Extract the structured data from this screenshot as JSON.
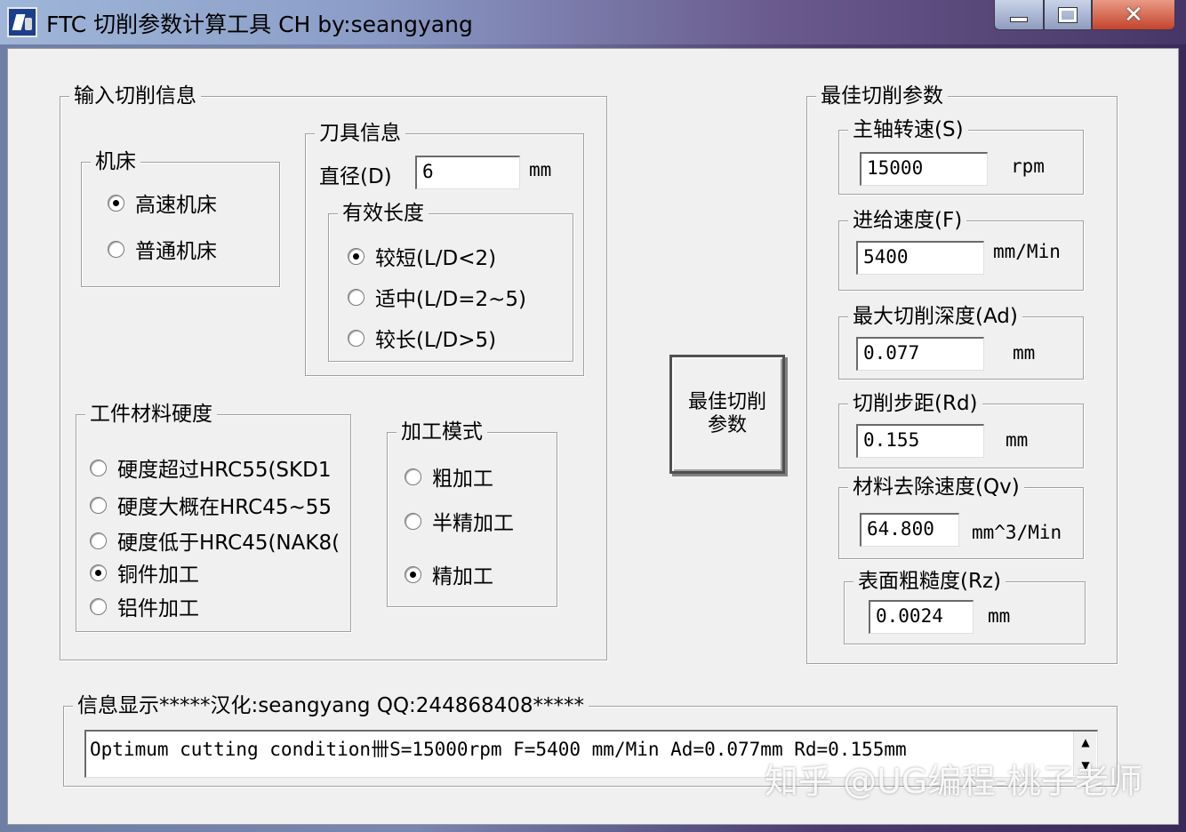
{
  "window": {
    "title": "FTC 切削参数计算工具  CH by:seangyang"
  },
  "input_group": {
    "title": "输入切削信息",
    "machine": {
      "title": "机床",
      "options": [
        {
          "label": "高速机床",
          "selected": true
        },
        {
          "label": "普通机床",
          "selected": false
        }
      ]
    },
    "tool": {
      "title": "刀具信息",
      "diameter_label": "直径(D)",
      "diameter_value": "6",
      "diameter_unit": "mm",
      "length": {
        "title": "有效长度",
        "options": [
          {
            "label": "较短(L/D<2)",
            "selected": true
          },
          {
            "label": "适中(L/D=2~5)",
            "selected": false
          },
          {
            "label": "较长(L/D>5)",
            "selected": false
          }
        ]
      }
    },
    "hardness": {
      "title": "工件材料硬度",
      "options": [
        {
          "label": "硬度超过HRC55(SKD1",
          "selected": false
        },
        {
          "label": "硬度大概在HRC45~55",
          "selected": false
        },
        {
          "label": "硬度低于HRC45(NAK8(",
          "selected": false
        },
        {
          "label": "铜件加工",
          "selected": true
        },
        {
          "label": "铝件加工",
          "selected": false
        }
      ]
    },
    "mode": {
      "title": "加工模式",
      "options": [
        {
          "label": "粗加工",
          "selected": false
        },
        {
          "label": "半精加工",
          "selected": false
        },
        {
          "label": "精加工",
          "selected": true
        }
      ]
    }
  },
  "calc_button": {
    "label": "最佳切削参数"
  },
  "output_group": {
    "title": "最佳切削参数",
    "fields": [
      {
        "title": "主轴转速(S)",
        "value": "15000",
        "unit": "rpm"
      },
      {
        "title": "进给速度(F)",
        "value": "5400",
        "unit": "mm/Min"
      },
      {
        "title": "最大切削深度(Ad)",
        "value": "0.077",
        "unit": "mm"
      },
      {
        "title": "切削步距(Rd)",
        "value": "0.155",
        "unit": "mm"
      },
      {
        "title": "材料去除速度(Qv)",
        "value": "64.800",
        "unit": "mm^3/Min"
      },
      {
        "title": "表面粗糙度(Rz)",
        "value": "0.0024",
        "unit": "mm"
      }
    ]
  },
  "info_group": {
    "title": "信息显示*****汉化:seangyang  QQ:244868408*****",
    "text": "Optimum cutting condition卌S=15000rpm F=5400 mm/Min Ad=0.077mm Rd=0.155mm"
  },
  "watermark": "知乎 @UG编程-桃子老师"
}
